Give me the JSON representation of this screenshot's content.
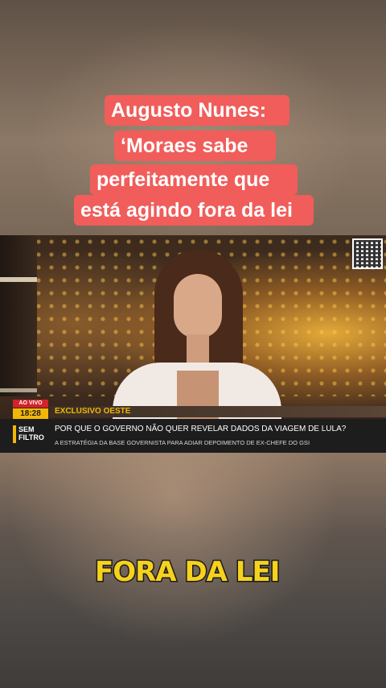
{
  "headline": {
    "lines": [
      "Augusto Nunes:",
      "‘Moraes sabe",
      "perfeitamente que",
      "está agindo fora da lei"
    ]
  },
  "broadcast": {
    "live_label": "AO VIVO",
    "time": "18:28",
    "section": "EXCLUSIVO OESTE",
    "logo_line1": "SEM",
    "logo_line2": "FILTRO",
    "headline": "POR QUE O GOVERNO NÃO QUER REVELAR DADOS DA VIAGEM DE LULA?",
    "subheadline": "A ESTRATÉGIA DA BASE GOVERNISTA PARA ADIAR DEPOIMENTO DE EX-CHEFE DO GSI"
  },
  "caption": {
    "text": "FORA DA LEI"
  },
  "colors": {
    "headline_bg": "#f05d5a",
    "live_red": "#d2232a",
    "accent_yellow": "#f2b705",
    "caption_yellow": "#f6d21c"
  },
  "icons": {
    "qr": "qr-code-icon"
  }
}
